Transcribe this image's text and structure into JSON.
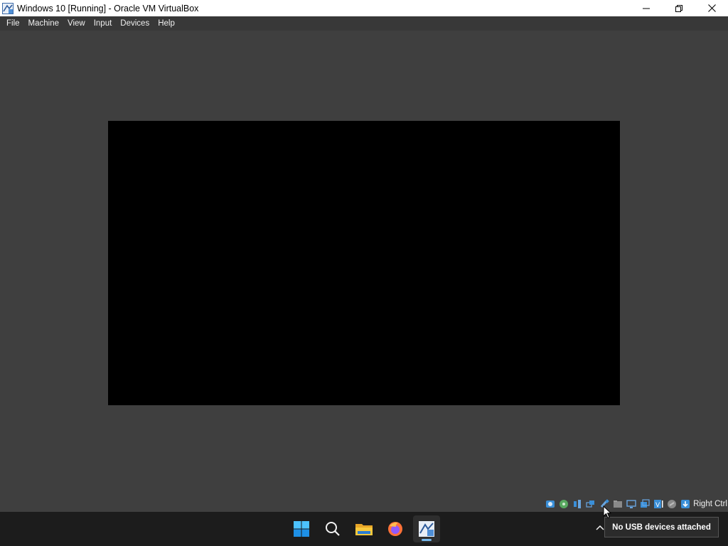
{
  "window": {
    "title": "Windows 10 [Running] - Oracle VM VirtualBox",
    "app_icon": "virtualbox-icon",
    "controls": [
      "minimize",
      "maximize",
      "close"
    ]
  },
  "menubar": {
    "items": [
      "File",
      "Machine",
      "View",
      "Input",
      "Devices",
      "Help"
    ]
  },
  "vm_display": {
    "background": "#000000"
  },
  "statusbar": {
    "icons": [
      "hard-disk-icon",
      "optical-drive-icon",
      "audio-icon",
      "network-icon",
      "usb-icon",
      "shared-folders-icon",
      "display-icon",
      "recording-icon",
      "virtualization-icon",
      "mouse-integration-icon",
      "keyboard-icon"
    ],
    "host_key": "Right Ctrl"
  },
  "taskbar": {
    "apps": [
      "start-icon",
      "search-icon",
      "file-explorer-icon",
      "firefox-icon",
      "virtualbox-icon"
    ],
    "active_app": "virtualbox-icon"
  },
  "tooltip": {
    "text": "No USB devices attached"
  },
  "colors": {
    "window_bg": "#3f3f3f",
    "menubar_bg": "#383838",
    "taskbar_bg": "#1c1c1c",
    "accent": "#76b9ed"
  }
}
